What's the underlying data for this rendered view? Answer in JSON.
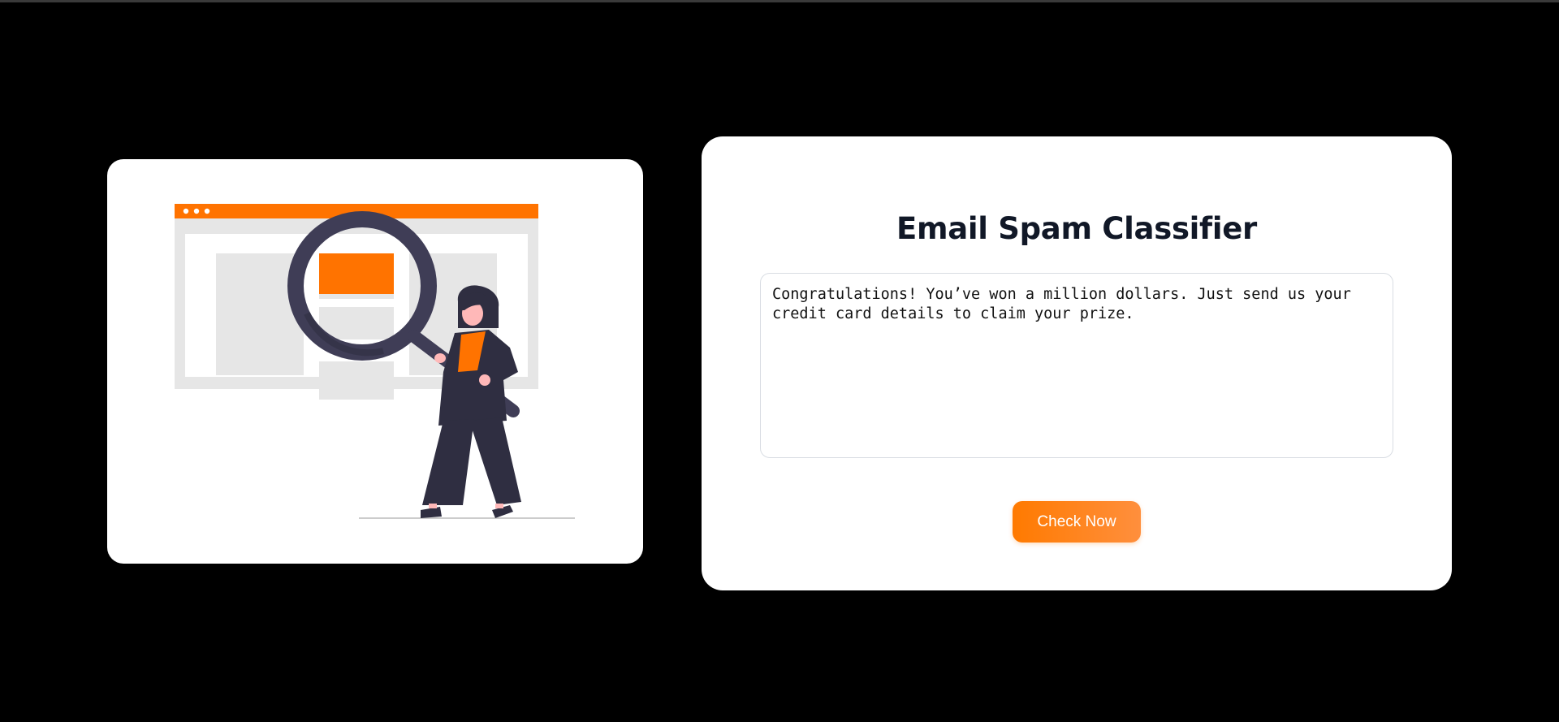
{
  "classifier": {
    "title": "Email Spam Classifier",
    "email_text": "Congratulations! You’ve won a million dollars. Just send us your credit card details to claim your prize.",
    "button_label": "Check Now"
  },
  "illustration": {
    "subject": "woman holding magnifying glass over web page",
    "icon": "search-illustration"
  },
  "colors": {
    "background": "#000000",
    "card": "#ffffff",
    "accent": "#ff7300",
    "figure_dark": "#3f3d56",
    "placeholder_gray": "#e6e6e6",
    "title_text": "#111827"
  }
}
